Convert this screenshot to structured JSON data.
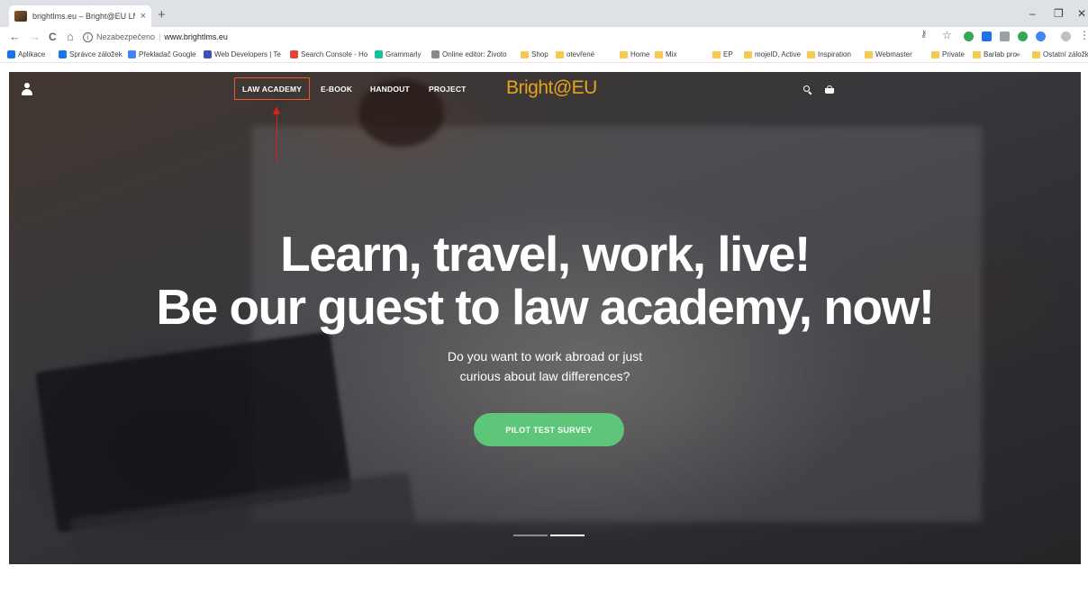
{
  "browser": {
    "tab_title": "brightlms.eu – Bright@EU LMS",
    "tab_close": "×",
    "new_tab": "+",
    "window_controls": {
      "minimize": "–",
      "maximize": "❐",
      "close": "✕"
    },
    "nav": {
      "back": "←",
      "forward": "→",
      "reload": "C",
      "home": "⌂"
    },
    "security_label": "Nezabezpečeno",
    "url": "www.brightlms.eu",
    "key_icon": "⚷",
    "star_icon": "☆",
    "menu_icon": "⋮",
    "extension_colors": [
      "#34a853",
      "#1a73e8",
      "#9aa0a6",
      "#34a853",
      "#4285f4",
      "#bdc1c6"
    ]
  },
  "bookmarks": {
    "items": [
      {
        "label": "Aplikace",
        "icon": "apps-icon"
      },
      {
        "label": "Správce záložek",
        "icon": "star-icon"
      },
      {
        "label": "Překladač Google",
        "icon": "translate-icon"
      },
      {
        "label": "Web Developers | Te",
        "icon": "web-dev-icon"
      },
      {
        "label": "Search Console - Ho",
        "icon": "google-icon"
      },
      {
        "label": "Grammarly",
        "icon": "grammarly-icon"
      },
      {
        "label": "Online editor: Životo",
        "icon": "editor-icon"
      },
      {
        "label": "Shop",
        "icon": "folder-icon"
      },
      {
        "label": "otevřené",
        "icon": "folder-icon"
      },
      {
        "label": "Home",
        "icon": "folder-icon"
      },
      {
        "label": "Mix",
        "icon": "folder-icon"
      },
      {
        "label": "EP",
        "icon": "folder-icon"
      },
      {
        "label": "mojeID, Active",
        "icon": "folder-icon"
      },
      {
        "label": "Inspiration",
        "icon": "folder-icon"
      },
      {
        "label": "Webmaster",
        "icon": "folder-icon"
      },
      {
        "label": "Private",
        "icon": "folder-icon"
      },
      {
        "label": "Barlab pro",
        "icon": "folder-icon"
      }
    ],
    "overflow": "»",
    "other": "Ostatní záložky"
  },
  "site": {
    "nav": {
      "law_academy": "LAW ACADEMY",
      "ebook": "E-BOOK",
      "handout": "HANDOUT",
      "project": "PROJECT"
    },
    "logo": "Bright@EU",
    "accent_color": "#e8562a",
    "logo_color": "#e6a21a",
    "hero": {
      "headline_1": "Learn, travel, work, live!",
      "headline_2": "Be our guest to law academy, now!",
      "subtext_1": "Do you want to work abroad or just",
      "subtext_2": "curious about law differences?",
      "cta": "PILOT TEST SURVEY",
      "cta_color": "#5ec679",
      "slides": 2,
      "active_slide": 2
    }
  }
}
